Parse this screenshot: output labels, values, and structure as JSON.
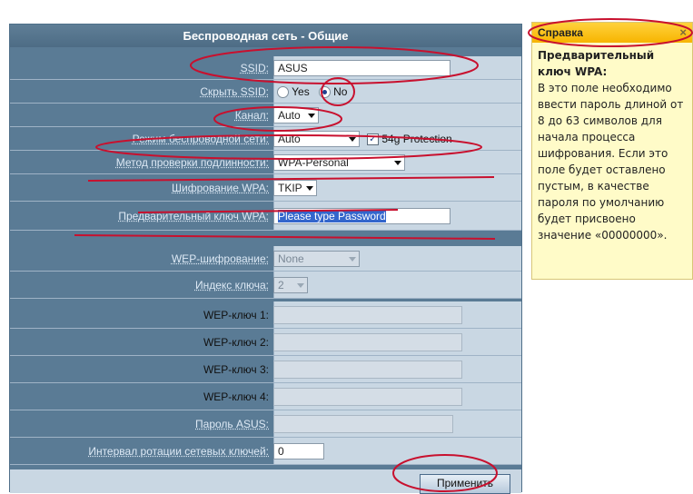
{
  "panel": {
    "title": "Беспроводная сеть - Общие",
    "ssid": {
      "label": "SSID:",
      "value": "ASUS"
    },
    "hide_ssid": {
      "label": "Скрыть SSID:",
      "yes": "Yes",
      "no": "No",
      "selected": "No"
    },
    "channel": {
      "label": "Канал:",
      "value": "Auto"
    },
    "wireless_mode": {
      "label": "Режим беспроводной сети:",
      "value": "Auto",
      "protection_label": "54g Protection",
      "protection_checked": true
    },
    "auth_method": {
      "label": "Метод проверки подлинности:",
      "value": "WPA-Personal"
    },
    "wpa_encryption": {
      "label": "Шифрование WPA:",
      "value": "TKIP"
    },
    "wpa_key": {
      "label": "Предварительный ключ WPA:",
      "value": "Please type Password"
    },
    "wep_encryption": {
      "label": "WEP-шифрование:",
      "value": "None"
    },
    "key_index": {
      "label": "Индекс ключа:",
      "value": "2"
    },
    "wep_key1": {
      "label": "WEP-ключ 1:",
      "value": ""
    },
    "wep_key2": {
      "label": "WEP-ключ 2:",
      "value": ""
    },
    "wep_key3": {
      "label": "WEP-ключ 3:",
      "value": ""
    },
    "wep_key4": {
      "label": "WEP-ключ 4:",
      "value": ""
    },
    "asus_password": {
      "label": "Пароль ASUS:",
      "value": ""
    },
    "key_rotation": {
      "label": "Интервал ротации сетевых ключей:",
      "value": "0"
    },
    "apply_label": "Применить"
  },
  "help": {
    "title": "Справка",
    "close": "×",
    "heading": "Предварительный ключ WPA:",
    "text": "В это поле необходимо ввести пароль длиной от 8 до 63 символов для начала процесса шифрования. Если это поле будет оставлено пустым, в качестве пароля по умолчанию будет присвоено значение «00000000»."
  },
  "colors": {
    "panel_bg": "#5a7b95",
    "field_bg": "#c9d7e3",
    "help_header": "#f7b400",
    "help_bg": "#fffbc8",
    "annotation": "#c8102e"
  }
}
